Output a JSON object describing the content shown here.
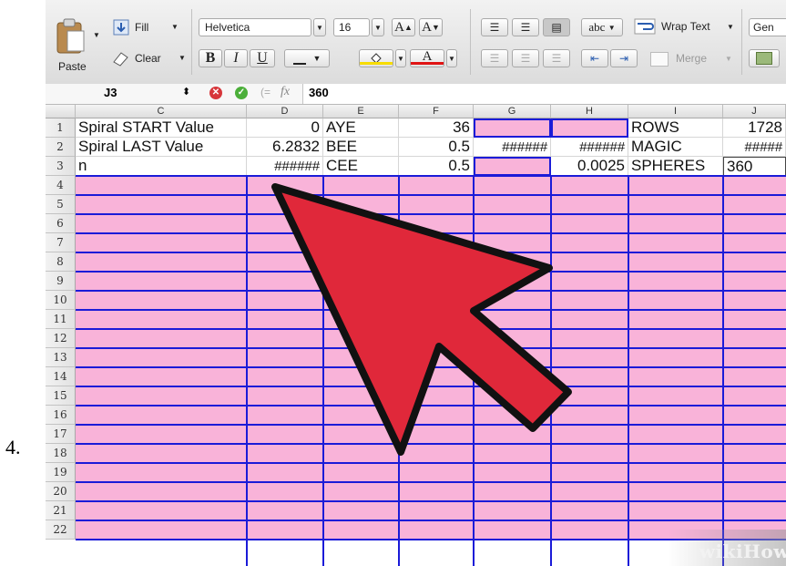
{
  "step_number": "4.",
  "ribbon": {
    "paste_label": "Paste",
    "fill_label": "Fill",
    "clear_label": "Clear",
    "font_name": "Helvetica",
    "font_size": "16",
    "grow_font": "A",
    "shrink_font": "A",
    "bold": "B",
    "italic": "I",
    "underline": "U",
    "text_color_letter": "A",
    "orientation_label": "abc",
    "wrap_text_label": "Wrap Text",
    "merge_label": "Merge",
    "number_format": "Gen",
    "fill_color": "#f7dc00",
    "text_color": "#e01414"
  },
  "formula_bar": {
    "cell_ref": "J3",
    "fx": "fx",
    "value": "360"
  },
  "grid": {
    "columns": [
      "C",
      "D",
      "E",
      "F",
      "G",
      "H",
      "I",
      "J"
    ],
    "row_numbers": [
      "1",
      "2",
      "3",
      "4",
      "5",
      "6",
      "7",
      "8",
      "9",
      "10",
      "11",
      "12",
      "13",
      "14",
      "15",
      "16",
      "17",
      "18",
      "19",
      "20",
      "21",
      "22"
    ],
    "rows": [
      [
        "Spiral START Value",
        "0",
        "AYE",
        "36",
        "",
        "",
        "ROWS",
        "1728"
      ],
      [
        "Spiral LAST Value",
        "6.2832",
        "BEE",
        "0.5",
        "######",
        "######",
        "MAGIC",
        "#####"
      ],
      [
        "n",
        "######",
        "CEE",
        "0.5",
        "",
        "0.0025",
        "SPHERES",
        "360"
      ]
    ],
    "pink": "#f9b3d9",
    "border_blue": "#1b1bd8"
  },
  "watermark": "wikiHow",
  "arrow_color": "#e0283a"
}
